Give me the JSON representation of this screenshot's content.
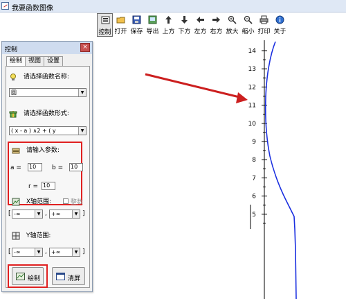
{
  "window": {
    "title": "我要函数图像"
  },
  "toolbar": {
    "buttons": [
      {
        "label": "控制",
        "icon": "control-icon"
      },
      {
        "label": "打开",
        "icon": "open-folder-icon"
      },
      {
        "label": "保存",
        "icon": "save-icon"
      },
      {
        "label": "导出",
        "icon": "export-icon"
      },
      {
        "label": "上方",
        "icon": "arrow-up-icon"
      },
      {
        "label": "下方",
        "icon": "arrow-down-icon"
      },
      {
        "label": "左方",
        "icon": "arrow-left-icon"
      },
      {
        "label": "右方",
        "icon": "arrow-right-icon"
      },
      {
        "label": "放大",
        "icon": "zoom-in-icon"
      },
      {
        "label": "缩小",
        "icon": "zoom-out-icon"
      },
      {
        "label": "打印",
        "icon": "print-icon"
      },
      {
        "label": "关于",
        "icon": "info-icon"
      }
    ]
  },
  "panel": {
    "title": "控制",
    "close": "×",
    "tabs": [
      "绘制",
      "视图",
      "设置"
    ],
    "function_name_label": "请选择函数名称:",
    "function_name_value": "圆",
    "function_form_label": "请选择函数形式:",
    "function_form_value": "( x - a ) ∧2 + ( y",
    "params_label": "请输入参数:",
    "param_a_label": "a =",
    "param_a_value": "10",
    "param_b_label": "b =",
    "param_b_value": "10",
    "param_r_label": "r =",
    "param_r_value": "10",
    "x_range_label": "X轴范围:",
    "x_integer_label": "整数",
    "x_min": "-∞",
    "x_max": "+∞",
    "y_range_label": "Y轴范围:",
    "y_min": "-∞",
    "y_max": "+∞",
    "draw_button": "绘制",
    "clear_button": "清屏"
  },
  "plot": {
    "y_ticks": [
      "14",
      "13",
      "12",
      "11",
      "10",
      "9",
      "8",
      "7",
      "6",
      "5"
    ],
    "colors": {
      "axis": "#000000",
      "curve": "#1a2fe0",
      "arrow": "#cc1f1f"
    }
  }
}
